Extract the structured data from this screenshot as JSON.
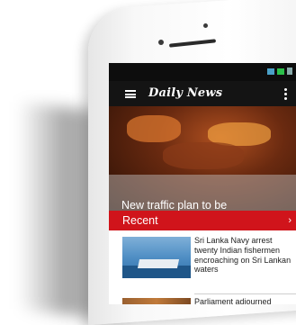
{
  "app": {
    "brand": "Daily News"
  },
  "hero": {
    "title": "New traffic plan to be introduced"
  },
  "section": {
    "label": "Recent",
    "chevron": "›"
  },
  "articles": [
    {
      "headline": "Sri Lanka Navy arrest twenty Indian fishermen encroaching on Sri Lankan waters",
      "thumbnail": "navy-boat-image"
    },
    {
      "headline": "Parliament adjourned",
      "thumbnail": "parliament-image"
    }
  ],
  "icons": [
    "menu-icon",
    "more-icon",
    "wifi-icon",
    "signal-icon",
    "battery-icon",
    "chevron-right-icon"
  ],
  "colors": {
    "accent": "#d0141b",
    "appbar": "#141414",
    "statusbar": "#0d0d0d"
  }
}
